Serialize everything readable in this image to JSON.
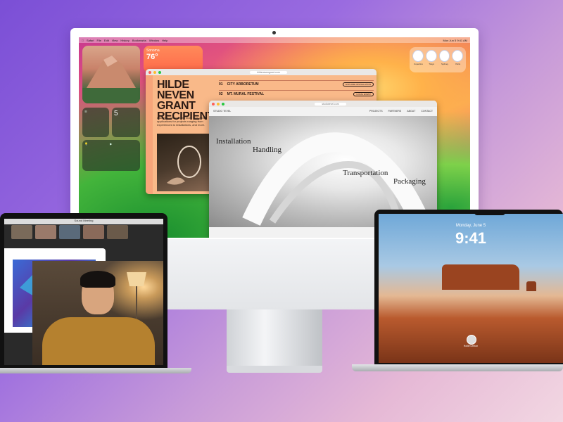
{
  "imac": {
    "menubar": {
      "items": [
        "Safari",
        "File",
        "Edit",
        "View",
        "History",
        "Bookmarks",
        "Window",
        "Help"
      ],
      "clock": "Mon Jun 5 9:41 AM"
    },
    "weather": {
      "city": "Sonoma",
      "temp": "76°"
    },
    "calendar": {
      "day": "5"
    },
    "clocks": [
      "Cupertino",
      "Tokyo",
      "Sydney",
      "Paris"
    ],
    "poster_window": {
      "url": "hildenevengrant.com",
      "title": "HILDE NEVEN GRANT RECIPIENT",
      "body": "Last year, we received more than 3,000 applications for projects ranging from experiences to installations, and more.",
      "events": [
        {
          "num": "01",
          "name": "CITY ARBORETUM",
          "tag": "EXPLORE INSTALLATION"
        },
        {
          "num": "02",
          "name": "MT. MURAL FESTIVAL",
          "tag": "LOCAL EVENT"
        }
      ]
    },
    "studio_window": {
      "url": "studiotevel.com",
      "brand": "STUDIO TEVEL",
      "nav": [
        "PROJECTS",
        "PARTNERS",
        "ABOUT",
        "CONTACT"
      ],
      "words": [
        "Installation",
        "Handling",
        "Transportation",
        "Packaging"
      ]
    },
    "dock_colors": [
      "#3b82f6",
      "#f59e0b",
      "#22c55e",
      "#60a5fa",
      "#ef4444",
      "#facc15",
      "#8b5cf6",
      "#fb923c",
      "#9ca3af",
      "#ffffff",
      "#6b7280",
      "#111827",
      "#ef4444",
      "#0ea5e9",
      "#3b82f6",
      "#22c55e",
      "#f97316",
      "#2563eb",
      "#9ca3af"
    ]
  },
  "left_laptop": {
    "facetime_title": "Sound Meeting",
    "tile_colors": [
      "#7a6a5a",
      "#9a7a6a",
      "#5a6a7a",
      "#8a6a5a",
      "#6a5a4a"
    ]
  },
  "right_laptop": {
    "date": "Monday, June 5",
    "time": "9:41",
    "user": "Hollie Lenton"
  }
}
